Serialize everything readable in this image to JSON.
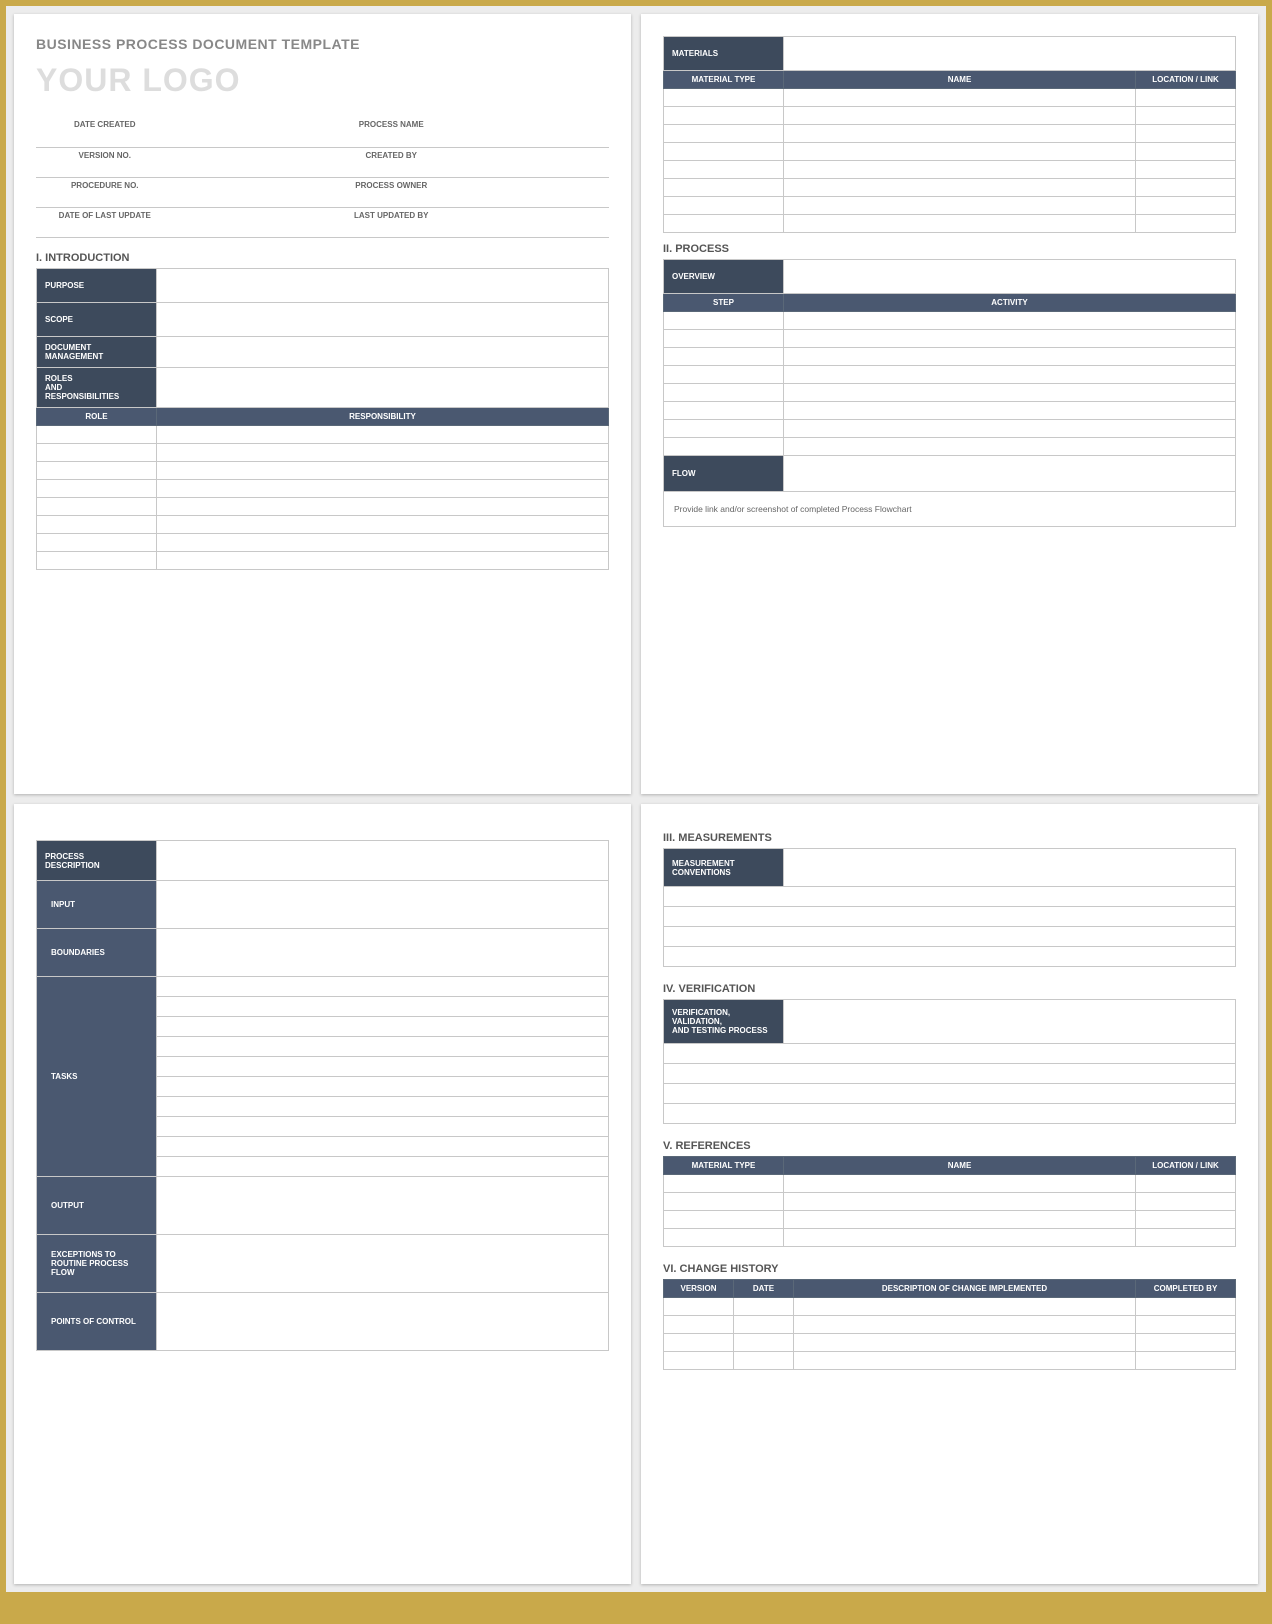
{
  "doc": {
    "title": "BUSINESS PROCESS DOCUMENT TEMPLATE",
    "logo": "YOUR LOGO",
    "meta": {
      "date_created": "DATE CREATED",
      "process_name": "PROCESS NAME",
      "version_no": "VERSION NO.",
      "created_by": "CREATED BY",
      "procedure_no": "PROCEDURE NO.",
      "process_owner": "PROCESS OWNER",
      "date_last_update": "DATE OF LAST UPDATE",
      "last_updated_by": "LAST UPDATED BY"
    },
    "s1": {
      "heading": "I.   INTRODUCTION",
      "purpose": "PURPOSE",
      "scope": "SCOPE",
      "doc_mgmt": "DOCUMENT MANAGEMENT",
      "roles": "ROLES\nAND\nRESPONSIBILITIES",
      "col_role": "ROLE",
      "col_resp": "RESPONSIBILITY"
    },
    "mat": {
      "heading": "MATERIALS",
      "col_type": "MATERIAL TYPE",
      "col_name": "NAME",
      "col_loc": "LOCATION / LINK"
    },
    "s2": {
      "heading": "II.  PROCESS",
      "overview": "OVERVIEW",
      "col_step": "STEP",
      "col_activity": "ACTIVITY",
      "flow": "FLOW",
      "flow_note": "Provide link and/or screenshot of completed Process Flowchart"
    },
    "p3": {
      "proc_desc": "PROCESS\nDESCRIPTION",
      "input": "INPUT",
      "boundaries": "BOUNDARIES",
      "tasks": "TASKS",
      "output": "OUTPUT",
      "exceptions": "EXCEPTIONS TO\nROUTINE PROCESS FLOW",
      "points": "POINTS OF CONTROL"
    },
    "s3": {
      "heading": "III. MEASUREMENTS",
      "conv": "MEASUREMENT\nCONVENTIONS"
    },
    "s4": {
      "heading": "IV. VERIFICATION",
      "ver": "VERIFICATION, VALIDATION,\nAND TESTING PROCESS"
    },
    "s5": {
      "heading": "V.  REFERENCES",
      "col_type": "MATERIAL TYPE",
      "col_name": "NAME",
      "col_loc": "LOCATION / LINK"
    },
    "s6": {
      "heading": "VI. CHANGE HISTORY",
      "col_ver": "VERSION",
      "col_date": "DATE",
      "col_desc": "DESCRIPTION OF CHANGE IMPLEMENTED",
      "col_by": "COMPLETED BY"
    }
  }
}
